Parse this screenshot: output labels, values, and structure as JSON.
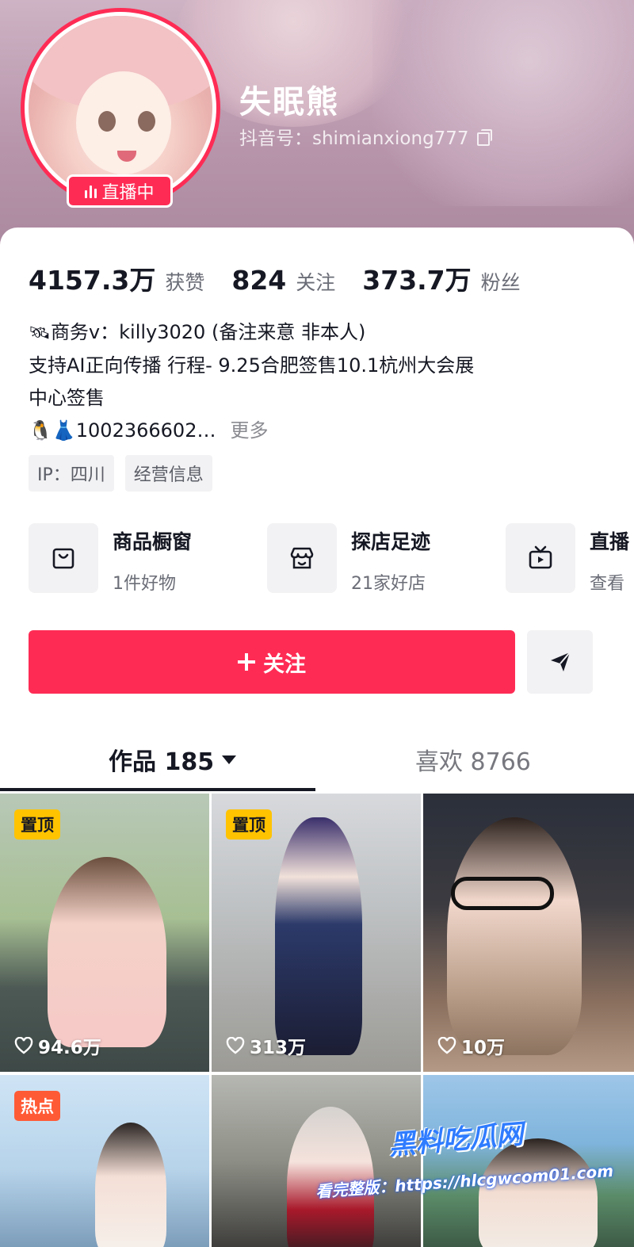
{
  "profile": {
    "nickname": "失眠熊",
    "douyin_id": "抖音号：shimianxiong777",
    "live_badge": "直播中"
  },
  "stats": [
    {
      "value": "4157.3万",
      "label": "获赞"
    },
    {
      "value": "824",
      "label": "关注"
    },
    {
      "value": "373.7万",
      "label": "粉丝"
    }
  ],
  "bio": {
    "line1_emoji": "🛰",
    "line1_text": "商务v：killy3020 (备注来意 非本人)",
    "line2": "支持AI正向传播 行程- 9.25合肥签售10.1杭州大会展",
    "line3": "中心签售",
    "line4": "🐧👗1002366602…",
    "more": "更多"
  },
  "tags": [
    "IP：四川",
    "经营信息"
  ],
  "features": [
    {
      "title": "商品橱窗",
      "subtitle": "1件好物",
      "icon": "shopping-bag-icon"
    },
    {
      "title": "探店足迹",
      "subtitle": "21家好店",
      "icon": "store-icon"
    },
    {
      "title": "直播",
      "subtitle": "查看",
      "icon": "tv-icon"
    }
  ],
  "actions": {
    "follow": "关注",
    "share_icon": "send-icon"
  },
  "tabs": {
    "works": "作品 185",
    "likes": "喜欢 8766"
  },
  "videos": [
    {
      "badge": "置顶",
      "badge_type": "pin",
      "likes": "94.6万"
    },
    {
      "badge": "置顶",
      "badge_type": "pin",
      "likes": "313万"
    },
    {
      "badge": "",
      "badge_type": "",
      "likes": "10万"
    },
    {
      "badge": "热点",
      "badge_type": "hot",
      "likes": ""
    },
    {
      "badge": "",
      "badge_type": "",
      "likes": ""
    },
    {
      "badge": "",
      "badge_type": "",
      "likes": ""
    }
  ],
  "watermark": {
    "logo": "黑料吃瓜网",
    "url": "看完整版：https://hlcgwcom01.com"
  },
  "colors": {
    "accent": "#fe2c55",
    "pin_badge": "#ffc300",
    "hot_badge": "#ff5a36"
  }
}
